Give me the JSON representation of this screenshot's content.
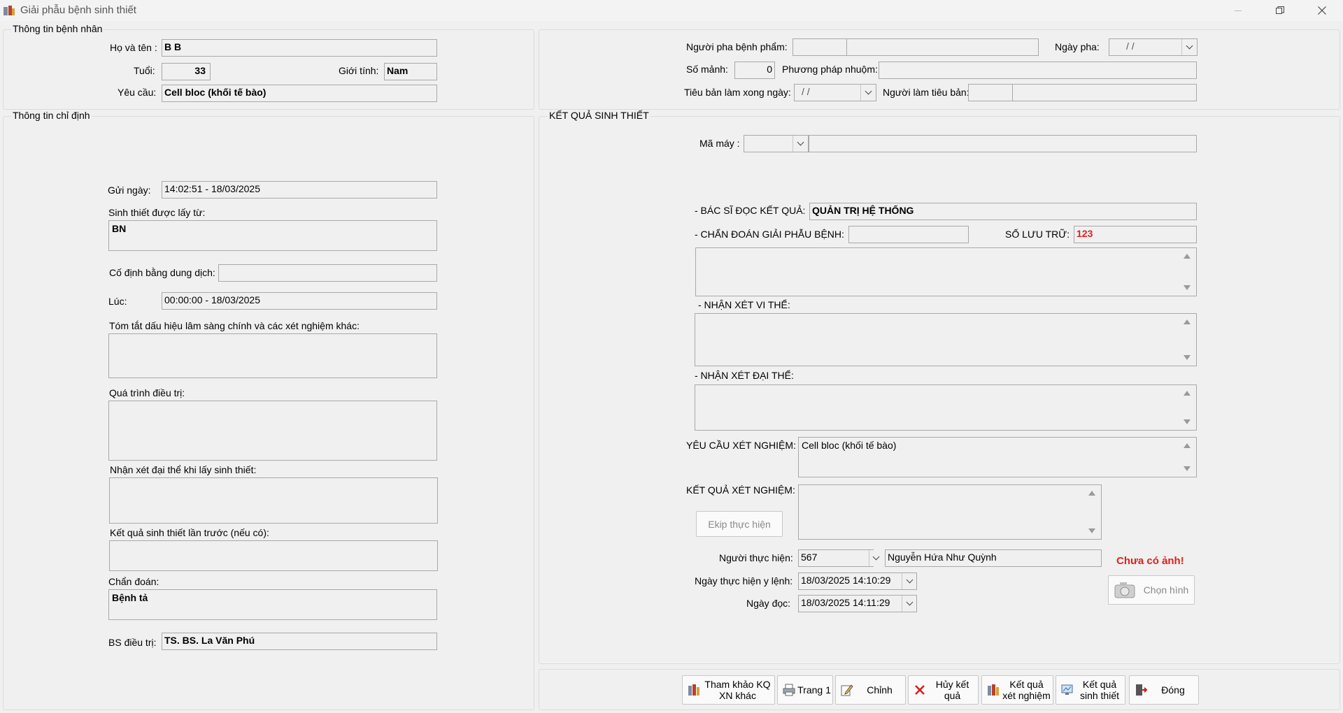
{
  "window": {
    "title": "Giải phẫu bệnh sinh thiết"
  },
  "patient": {
    "group_title": "Thông tin bệnh nhân",
    "name_label": "Họ và tên :",
    "name": "B B",
    "age_label": "Tuổi:",
    "age": "33",
    "gender_label": "Giới tính:",
    "gender": "Nam",
    "request_label": "Yêu cầu:",
    "request": "Cell bloc (khối tế bào)"
  },
  "specimen": {
    "preparer_label": "Người pha bệnh phẩm:",
    "preparer_code": "",
    "preparer_name": "",
    "prep_date_label": "Ngày pha:",
    "prep_date": "/ /",
    "pieces_label": "Số mảnh:",
    "pieces": "0",
    "stain_label": "Phương pháp nhuộm:",
    "stain": "",
    "slide_done_label": "Tiêu bản làm xong ngày:",
    "slide_done": "/ /",
    "slide_maker_label": "Người làm tiêu bản:",
    "slide_maker_code": "",
    "slide_maker_name": ""
  },
  "order": {
    "group_title": "Thông tin chỉ định",
    "sent_label": "Gửi ngày:",
    "sent_value": "14:02:51   -   18/03/2025",
    "source_label": "Sinh thiết được lấy từ:",
    "source_value": "BN",
    "fix_label": "Cố định bằng dung dịch:",
    "fix_value": "",
    "at_label": "Lúc:",
    "at_value": "00:00:00   -   18/03/2025",
    "summary_label": "Tóm tắt dấu hiệu lâm sàng chính và các xét nghiệm khác:",
    "summary_value": "",
    "treatment_label": "Quá trình điều trị:",
    "treatment_value": "",
    "gross_label": "Nhận xét đại thể khi lấy sinh thiết:",
    "gross_value": "",
    "prev_label": "Kết quả sinh thiết lần trước (nếu có):",
    "prev_value": "",
    "diag_label": "Chẩn đoán:",
    "diag_value": "Bệnh tả",
    "doctor_label": "BS điều trị:",
    "doctor_value": "TS. BS. La Văn Phú"
  },
  "result": {
    "group_title": "KẾT QUẢ SINH THIẾT",
    "machine_label": "Mã máy :",
    "machine_code": "",
    "machine_name": "",
    "reader_label": "- BÁC SĨ ĐỌC KẾT QUẢ:",
    "reader_value": "QUẢN TRỊ HỆ THỐNG",
    "diag_label": "- CHẨN ĐOÁN GIẢI PHẪU BỆNH:",
    "diag_value": "",
    "archive_label": "SỐ LƯU TRỮ:",
    "archive_value": "123",
    "diag_text": "",
    "micro_label": "- NHẬN XÉT VI THỂ:",
    "micro_text": "",
    "macro_label": "- NHẬN XÉT ĐẠI THỂ:",
    "macro_text": "",
    "test_request_label": "YÊU CẦU XÉT NGHIỆM:",
    "test_request_text": "Cell bloc (khối tế bào)",
    "test_result_label": "KẾT QUẢ XÉT NGHIỆM:",
    "test_result_text": "",
    "team_button": "Ekip thực hiện",
    "performer_label": "Người thực hiện:",
    "performer_code": "567",
    "performer_name": "Nguyễn Hứa Như Quỳnh",
    "exec_date_label": "Ngày thực hiện y lệnh:",
    "exec_date": "18/03/2025  14:10:29",
    "read_date_label": "Ngày đọc:",
    "read_date": "18/03/2025  14:11:29",
    "no_image": "Chưa có ảnh!",
    "choose_image": "Chọn hình"
  },
  "toolbar": {
    "ref_other": [
      "Tham khảo KQ",
      "XN khác"
    ],
    "page1": "Trang 1",
    "edit": "Chỉnh",
    "cancel_result": [
      "Hủy kết",
      "quả"
    ],
    "test_result": [
      "Kết quả",
      "xét nghiệm"
    ],
    "biopsy_result": [
      "Kết quả",
      "sinh thiết"
    ],
    "close": "Đóng"
  },
  "colors": {
    "accent_red": "#e0201b",
    "field_bg": "#f0f0f0",
    "window_bg": "#f0f0f0"
  }
}
